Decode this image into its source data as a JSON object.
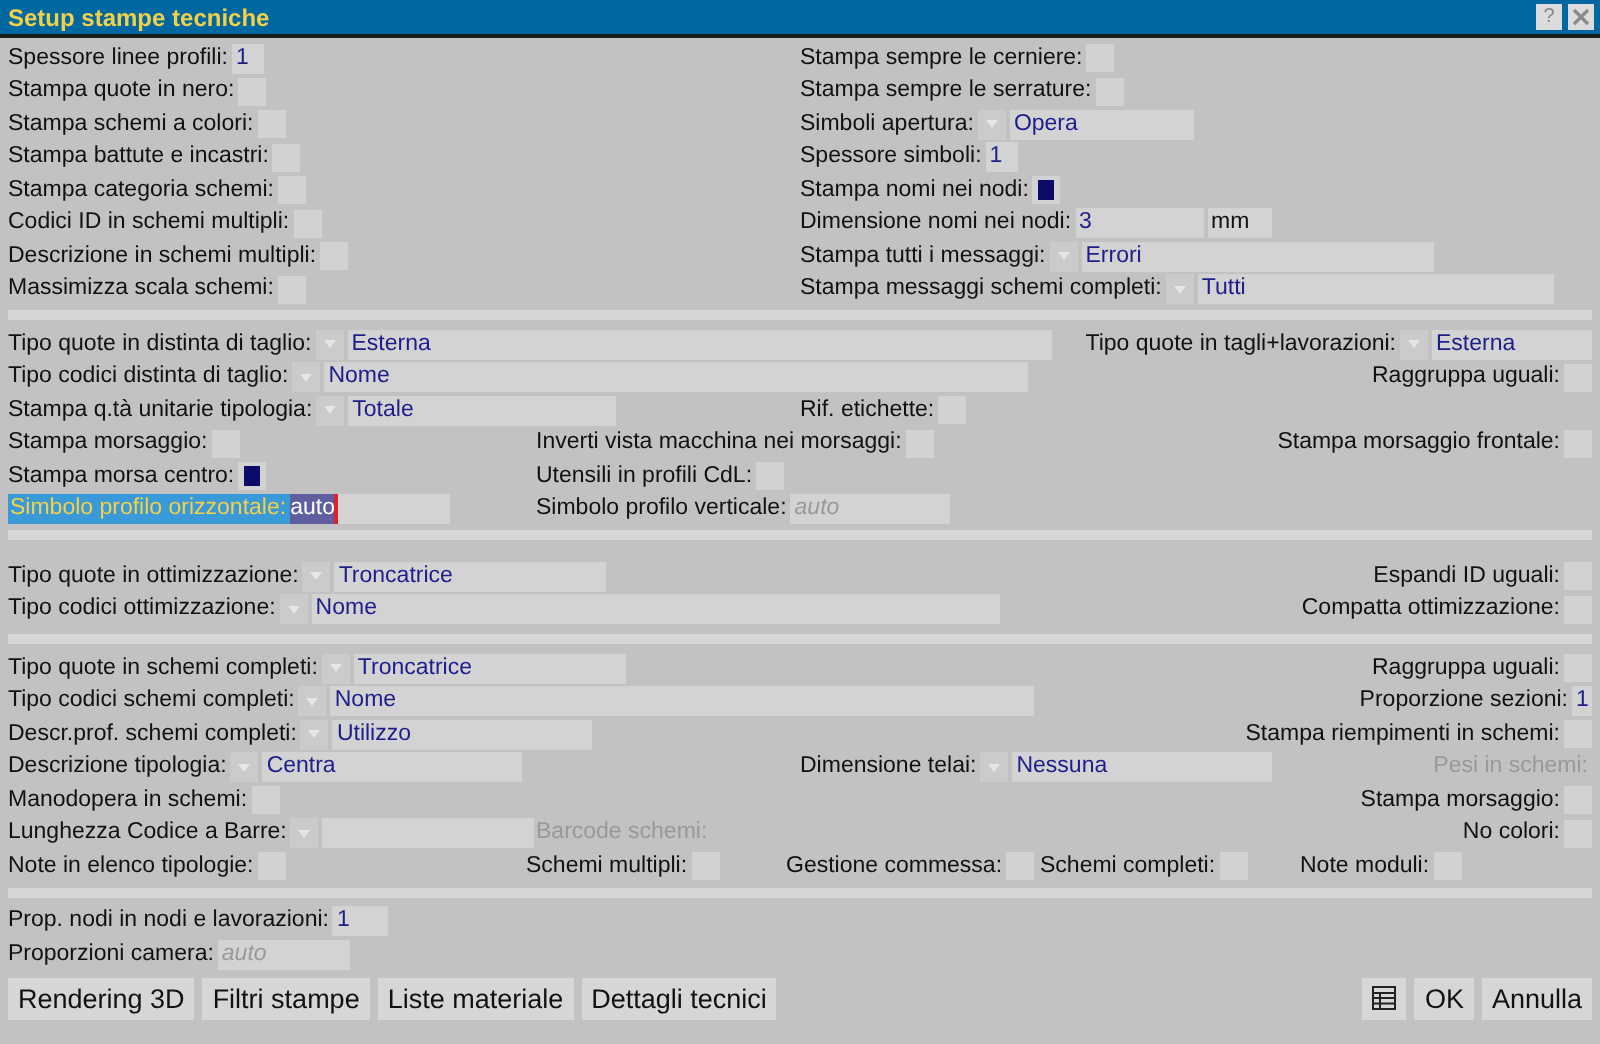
{
  "window": {
    "title": "Setup stampe tecniche",
    "help": "?"
  },
  "sections": [
    {
      "rows": [
        {
          "items": [
            {
              "kind": "text",
              "label": "Spessore linee profili:",
              "value": "1"
            },
            {
              "kind": "check",
              "label": "Stampa sempre le cerniere:",
              "checked": false
            }
          ]
        },
        {
          "items": [
            {
              "kind": "check",
              "label": "Stampa quote in nero:",
              "checked": false
            },
            {
              "kind": "check",
              "label": "Stampa sempre le serrature:",
              "checked": false
            }
          ]
        },
        {
          "items": [
            {
              "kind": "check",
              "label": "Stampa schemi a colori:",
              "checked": false
            },
            {
              "kind": "combo",
              "label": "Simboli apertura:",
              "value": "Opera"
            }
          ]
        },
        {
          "items": [
            {
              "kind": "check",
              "label": "Stampa battute e incastri:",
              "checked": false
            },
            {
              "kind": "text",
              "label": "Spessore simboli:",
              "value": "1"
            }
          ]
        },
        {
          "items": [
            {
              "kind": "check",
              "label": "Stampa categoria schemi:",
              "checked": false
            },
            {
              "kind": "check",
              "label": "Stampa nomi nei nodi:",
              "checked": true
            }
          ]
        },
        {
          "items": [
            {
              "kind": "check",
              "label": "Codici ID in schemi multipli:",
              "checked": false
            },
            {
              "kind": "text",
              "label": "Dimensione nomi nei nodi:",
              "value": "3",
              "unit": "mm"
            }
          ]
        },
        {
          "items": [
            {
              "kind": "check",
              "label": "Descrizione in schemi multipli:",
              "checked": false
            },
            {
              "kind": "combo",
              "label": "Stampa tutti i messaggi:",
              "value": "Errori"
            }
          ]
        },
        {
          "items": [
            {
              "kind": "check",
              "label": "Massimizza scala schemi:",
              "checked": false
            },
            {
              "kind": "combo",
              "label": "Stampa messaggi schemi completi:",
              "value": "Tutti"
            }
          ]
        }
      ]
    },
    {
      "rows": [
        {
          "items": [
            {
              "kind": "combo",
              "label": "Tipo quote in distinta di taglio:",
              "value": "Esterna"
            },
            {
              "kind": "combo",
              "label": "Tipo quote in tagli+lavorazioni:",
              "value": "Esterna"
            }
          ]
        },
        {
          "items": [
            {
              "kind": "combo",
              "label": "Tipo codici distinta di taglio:",
              "value": "Nome"
            },
            {
              "kind": "check",
              "label": "Raggruppa uguali:",
              "checked": false
            }
          ]
        },
        {
          "items": [
            {
              "kind": "combo",
              "label": "Stampa q.tà unitarie tipologia:",
              "value": "Totale"
            },
            {
              "kind": "check",
              "label": "Rif. etichette:",
              "checked": false
            }
          ]
        },
        {
          "items": [
            {
              "kind": "check",
              "label": "Stampa morsaggio:",
              "checked": false
            },
            {
              "kind": "check",
              "label": "Inverti vista macchina nei morsaggi:",
              "checked": false
            },
            {
              "kind": "check",
              "label": "Stampa morsaggio frontale:",
              "checked": false
            }
          ]
        },
        {
          "items": [
            {
              "kind": "check",
              "label": "Stampa morsa centro:",
              "checked": true
            },
            {
              "kind": "check",
              "label": "Utensili in profili CdL:",
              "checked": false
            }
          ]
        },
        {
          "items": [
            {
              "kind": "focus_text",
              "label": "Simbolo profilo orizzontale:",
              "value": "auto"
            },
            {
              "kind": "text",
              "label": "Simbolo profilo verticale:",
              "placeholder": "auto"
            }
          ]
        }
      ]
    },
    {
      "rows": [
        {
          "items": [
            {
              "kind": "combo",
              "label": "Tipo quote in ottimizzazione:",
              "value": "Troncatrice"
            },
            {
              "kind": "check",
              "label": "Espandi ID uguali:",
              "checked": false
            }
          ]
        },
        {
          "items": [
            {
              "kind": "combo",
              "label": "Tipo codici ottimizzazione:",
              "value": "Nome"
            },
            {
              "kind": "check",
              "label": "Compatta ottimizzazione:",
              "checked": false
            }
          ]
        }
      ]
    },
    {
      "rows": [
        {
          "items": [
            {
              "kind": "combo",
              "label": "Tipo quote in schemi completi:",
              "value": "Troncatrice"
            },
            {
              "kind": "check",
              "label": "Raggruppa uguali:",
              "checked": false
            }
          ]
        },
        {
          "items": [
            {
              "kind": "combo",
              "label": "Tipo codici schemi completi:",
              "value": "Nome"
            },
            {
              "kind": "text",
              "label": "Proporzione sezioni:",
              "value": "1"
            }
          ]
        },
        {
          "items": [
            {
              "kind": "combo",
              "label": "Descr.prof. schemi completi:",
              "value": "Utilizzo"
            },
            {
              "kind": "check",
              "label": "Stampa riempimenti in schemi:",
              "checked": false
            }
          ]
        },
        {
          "items": [
            {
              "kind": "combo",
              "label": "Descrizione tipologia:",
              "value": "Centra"
            },
            {
              "kind": "combo",
              "label": "Dimensione telai:",
              "value": "Nessuna"
            },
            {
              "kind": "inactive",
              "label": "Pesi in schemi:"
            }
          ]
        },
        {
          "items": [
            {
              "kind": "check",
              "label": "Manodopera in schemi:",
              "checked": false
            },
            {
              "kind": "check",
              "label": "Stampa morsaggio:",
              "checked": false
            }
          ]
        },
        {
          "items": [
            {
              "kind": "combo",
              "label": "Lunghezza Codice a Barre:"
            },
            {
              "kind": "inactive",
              "label": "Barcode schemi:"
            },
            {
              "kind": "check",
              "label": "No colori:",
              "checked": false
            }
          ]
        },
        {
          "items": [
            {
              "kind": "check",
              "label": "Note in elenco tipologie:",
              "checked": false
            },
            {
              "kind": "check",
              "label": "Schemi multipli:",
              "checked": false
            },
            {
              "kind": "check",
              "label": "Gestione commessa:",
              "checked": false
            },
            {
              "kind": "check",
              "label": "Schemi completi:",
              "checked": false
            },
            {
              "kind": "check",
              "label": "Note moduli:",
              "checked": false
            }
          ]
        }
      ]
    },
    {
      "rows": [
        {
          "items": [
            {
              "kind": "text",
              "label": "Prop. nodi in nodi e lavorazioni:",
              "value": "1"
            }
          ]
        },
        {
          "items": [
            {
              "kind": "text",
              "label": "Proporzioni camera:",
              "placeholder": "auto"
            }
          ]
        }
      ]
    }
  ],
  "buttons": [
    {
      "label": "Rendering 3D"
    },
    {
      "label": "Filtri stampe"
    },
    {
      "label": "Liste materiale"
    },
    {
      "label": "Dettagli tecnici"
    }
  ],
  "dialog_buttons": [
    {
      "kind": "icon"
    },
    {
      "kind": "text",
      "label": "OK"
    },
    {
      "kind": "text",
      "label": "Annulla"
    }
  ]
}
